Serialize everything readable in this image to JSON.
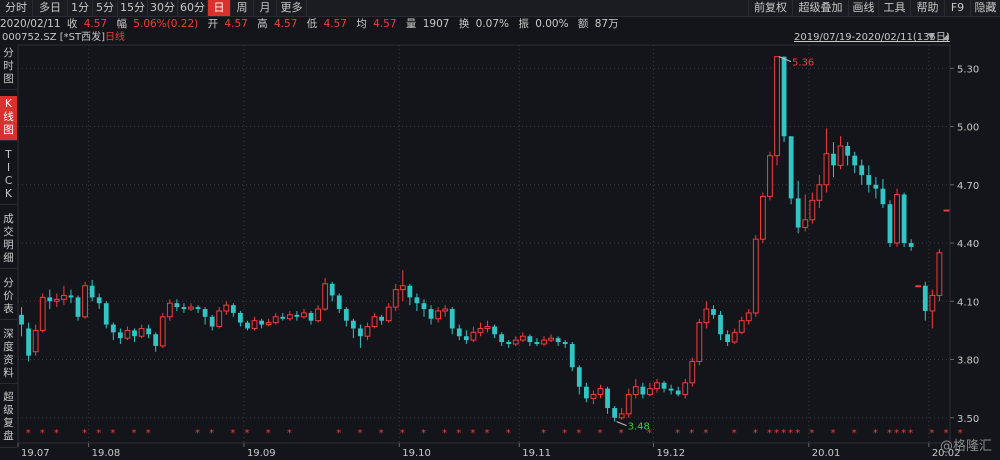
{
  "top_tabs": [
    "分时",
    "多日",
    "1分",
    "5分",
    "15分",
    "30分",
    "60分",
    "日",
    "周",
    "月",
    "更多"
  ],
  "active_tab": "日",
  "right_menu": [
    "前复权",
    "超级叠加",
    "画线",
    "工具",
    "帮助",
    "F9",
    "隐藏"
  ],
  "quote": {
    "date": "2020/02/11",
    "close_label": "收",
    "close": "4.57",
    "change_label": "幅",
    "change": "5.06%(0.22)",
    "open_label": "开",
    "open": "4.57",
    "high_label": "高",
    "high": "4.57",
    "low_label": "低",
    "low": "4.57",
    "avg_label": "均",
    "avg": "4.57",
    "volume_label": "量",
    "volume": "1907",
    "turnover_label": "换",
    "turnover": "0.07%",
    "amplitude_label": "振",
    "amplitude": "0.00%",
    "amount_label": "额",
    "amount": "87万"
  },
  "stock": {
    "code_name": "000752.SZ [*ST西发]",
    "period": "日线"
  },
  "range_label": "2019/07/19-2020/02/11(135日)",
  "sidebar": [
    "分时图",
    "K线图",
    "TICK",
    "成交明细",
    "分价表",
    "深度资料",
    "超级复盘"
  ],
  "watermark": "@格隆汇",
  "colors": {
    "up": "#f23c3c",
    "down": "#31c5c5",
    "background": "#14151a",
    "grid": "#3a3b40",
    "low_label": "#3ccb3c",
    "accent": "#d8312e"
  },
  "chart_data": {
    "type": "candlestick",
    "ylim": [
      3.37,
      5.42
    ],
    "y_ticks": [
      "5.30",
      "5.00",
      "4.70",
      "4.40",
      "4.10",
      "3.80",
      "3.50"
    ],
    "x_tick_labels": [
      "19.07",
      "19.08",
      "19.09",
      "19.10",
      "19.11",
      "19.12",
      "20.01",
      "20.02"
    ],
    "x_tick_index": [
      0,
      10,
      32,
      54,
      71,
      90,
      112,
      129
    ],
    "max_label": "5.36",
    "min_label": "3.48",
    "candles": [
      [
        4.03,
        3.98,
        4.07,
        3.92
      ],
      [
        3.96,
        3.82,
        3.99,
        3.79
      ],
      [
        3.84,
        3.95,
        3.98,
        3.82
      ],
      [
        3.95,
        4.12,
        4.14,
        3.94
      ],
      [
        4.12,
        4.1,
        4.16,
        4.06
      ],
      [
        4.1,
        4.11,
        4.14,
        4.07
      ],
      [
        4.11,
        4.13,
        4.18,
        4.08
      ],
      [
        4.13,
        4.12,
        4.16,
        4.09
      ],
      [
        4.12,
        4.02,
        4.13,
        4.0
      ],
      [
        4.02,
        4.18,
        4.2,
        4.01
      ],
      [
        4.18,
        4.12,
        4.21,
        4.1
      ],
      [
        4.12,
        4.09,
        4.14,
        4.06
      ],
      [
        4.09,
        3.98,
        4.1,
        3.96
      ],
      [
        3.98,
        3.94,
        3.99,
        3.9
      ],
      [
        3.94,
        3.91,
        3.96,
        3.88
      ],
      [
        3.91,
        3.95,
        3.97,
        3.9
      ],
      [
        3.95,
        3.92,
        3.96,
        3.89
      ],
      [
        3.92,
        3.96,
        3.98,
        3.91
      ],
      [
        3.96,
        3.93,
        3.98,
        3.91
      ],
      [
        3.93,
        3.87,
        3.94,
        3.84
      ],
      [
        3.87,
        4.02,
        4.04,
        3.86
      ],
      [
        4.02,
        4.09,
        4.11,
        4.0
      ],
      [
        4.09,
        4.07,
        4.11,
        4.05
      ],
      [
        4.07,
        4.06,
        4.09,
        4.04
      ],
      [
        4.06,
        4.07,
        4.09,
        4.05
      ],
      [
        4.07,
        4.06,
        4.08,
        4.04
      ],
      [
        4.06,
        4.02,
        4.07,
        3.98
      ],
      [
        4.02,
        3.97,
        4.03,
        3.95
      ],
      [
        3.97,
        4.05,
        4.07,
        3.96
      ],
      [
        4.05,
        4.08,
        4.1,
        4.03
      ],
      [
        4.08,
        4.04,
        4.09,
        4.02
      ],
      [
        4.04,
        3.99,
        4.05,
        3.97
      ],
      [
        3.99,
        3.96,
        4.0,
        3.95
      ],
      [
        3.96,
        4.0,
        4.02,
        3.95
      ],
      [
        4.0,
        3.98,
        4.01,
        3.96
      ],
      [
        3.98,
        3.99,
        4.01,
        3.97
      ],
      [
        3.99,
        4.02,
        4.04,
        3.98
      ],
      [
        4.02,
        4.01,
        4.04,
        4.0
      ],
      [
        4.01,
        4.03,
        4.05,
        4.0
      ],
      [
        4.03,
        4.02,
        4.05,
        4.0
      ],
      [
        4.02,
        4.04,
        4.06,
        4.01
      ],
      [
        4.04,
        4.0,
        4.05,
        3.98
      ],
      [
        4.0,
        4.06,
        4.08,
        3.99
      ],
      [
        4.06,
        4.19,
        4.22,
        4.05
      ],
      [
        4.19,
        4.13,
        4.2,
        4.1
      ],
      [
        4.13,
        4.06,
        4.14,
        4.04
      ],
      [
        4.06,
        4.0,
        4.07,
        3.97
      ],
      [
        4.0,
        3.96,
        4.01,
        3.91
      ],
      [
        3.96,
        3.92,
        3.98,
        3.86
      ],
      [
        3.92,
        3.97,
        3.99,
        3.9
      ],
      [
        3.97,
        4.02,
        4.04,
        3.96
      ],
      [
        4.02,
        4.0,
        4.03,
        3.98
      ],
      [
        4.0,
        4.07,
        4.09,
        3.99
      ],
      [
        4.07,
        4.16,
        4.19,
        4.05
      ],
      [
        4.16,
        4.18,
        4.26,
        4.1
      ],
      [
        4.18,
        4.12,
        4.19,
        4.08
      ],
      [
        4.12,
        4.09,
        4.14,
        4.05
      ],
      [
        4.09,
        4.06,
        4.11,
        4.02
      ],
      [
        4.06,
        4.01,
        4.08,
        3.98
      ],
      [
        4.01,
        4.05,
        4.07,
        3.99
      ],
      [
        4.05,
        4.06,
        4.08,
        4.02
      ],
      [
        4.06,
        3.96,
        4.07,
        3.93
      ],
      [
        3.96,
        3.92,
        3.98,
        3.9
      ],
      [
        3.92,
        3.9,
        3.95,
        3.88
      ],
      [
        3.9,
        3.94,
        3.97,
        3.89
      ],
      [
        3.94,
        3.96,
        3.99,
        3.92
      ],
      [
        3.96,
        3.97,
        4.0,
        3.94
      ],
      [
        3.97,
        3.93,
        3.98,
        3.91
      ],
      [
        3.93,
        3.89,
        3.94,
        3.87
      ],
      [
        3.89,
        3.88,
        3.9,
        3.86
      ],
      [
        3.88,
        3.9,
        3.92,
        3.87
      ],
      [
        3.9,
        3.92,
        3.94,
        3.89
      ],
      [
        3.92,
        3.89,
        3.93,
        3.87
      ],
      [
        3.89,
        3.88,
        3.91,
        3.87
      ],
      [
        3.88,
        3.9,
        3.92,
        3.87
      ],
      [
        3.9,
        3.91,
        3.93,
        3.89
      ],
      [
        3.91,
        3.89,
        3.92,
        3.87
      ],
      [
        3.89,
        3.88,
        3.9,
        3.86
      ],
      [
        3.88,
        3.76,
        3.89,
        3.74
      ],
      [
        3.76,
        3.66,
        3.77,
        3.62
      ],
      [
        3.66,
        3.6,
        3.68,
        3.58
      ],
      [
        3.6,
        3.62,
        3.64,
        3.57
      ],
      [
        3.62,
        3.65,
        3.67,
        3.6
      ],
      [
        3.65,
        3.55,
        3.66,
        3.52
      ],
      [
        3.55,
        3.5,
        3.56,
        3.48
      ],
      [
        3.5,
        3.52,
        3.55,
        3.49
      ],
      [
        3.52,
        3.62,
        3.65,
        3.5
      ],
      [
        3.62,
        3.66,
        3.7,
        3.6
      ],
      [
        3.66,
        3.62,
        3.68,
        3.6
      ],
      [
        3.62,
        3.65,
        3.68,
        3.61
      ],
      [
        3.65,
        3.68,
        3.7,
        3.63
      ],
      [
        3.68,
        3.65,
        3.69,
        3.63
      ],
      [
        3.65,
        3.64,
        3.67,
        3.62
      ],
      [
        3.64,
        3.62,
        3.66,
        3.61
      ],
      [
        3.62,
        3.68,
        3.7,
        3.6
      ],
      [
        3.68,
        3.79,
        3.81,
        3.66
      ],
      [
        3.79,
        3.99,
        4.01,
        3.77
      ],
      [
        3.99,
        4.06,
        4.1,
        3.96
      ],
      [
        4.06,
        4.03,
        4.08,
        4.01
      ],
      [
        4.03,
        3.93,
        4.05,
        3.9
      ],
      [
        3.93,
        3.89,
        3.95,
        3.87
      ],
      [
        3.89,
        3.94,
        3.96,
        3.88
      ],
      [
        3.94,
        4.0,
        4.02,
        3.93
      ],
      [
        4.0,
        4.04,
        4.06,
        3.98
      ],
      [
        4.04,
        4.42,
        4.44,
        4.02
      ],
      [
        4.42,
        4.64,
        4.66,
        4.4
      ],
      [
        4.64,
        4.85,
        4.87,
        4.62
      ],
      [
        4.85,
        5.36,
        5.36,
        4.8
      ],
      [
        5.36,
        4.95,
        5.02,
        4.92
      ],
      [
        4.95,
        4.63,
        4.9,
        4.6
      ],
      [
        4.63,
        4.48,
        4.72,
        4.45
      ],
      [
        4.48,
        4.52,
        4.65,
        4.46
      ],
      [
        4.52,
        4.62,
        4.66,
        4.5
      ],
      [
        4.62,
        4.7,
        4.75,
        4.58
      ],
      [
        4.7,
        4.86,
        4.99,
        4.66
      ],
      [
        4.86,
        4.8,
        4.92,
        4.74
      ],
      [
        4.8,
        4.9,
        4.95,
        4.78
      ],
      [
        4.9,
        4.85,
        4.92,
        4.8
      ],
      [
        4.85,
        4.8,
        4.87,
        4.76
      ],
      [
        4.8,
        4.75,
        4.83,
        4.7
      ],
      [
        4.75,
        4.7,
        4.8,
        4.66
      ],
      [
        4.7,
        4.68,
        4.74,
        4.63
      ],
      [
        4.68,
        4.6,
        4.73,
        4.58
      ],
      [
        4.6,
        4.4,
        4.62,
        4.38
      ],
      [
        4.4,
        4.65,
        4.68,
        4.38
      ],
      [
        4.65,
        4.4,
        4.66,
        4.38
      ],
      [
        4.4,
        4.38,
        4.42,
        4.36
      ],
      [
        4.18,
        4.18,
        4.18,
        4.18
      ],
      [
        4.18,
        4.05,
        4.2,
        4.0
      ],
      [
        4.05,
        4.13,
        4.16,
        3.96
      ],
      [
        4.13,
        4.35,
        4.37,
        4.1
      ],
      [
        4.57,
        4.57,
        4.57,
        4.57
      ]
    ],
    "marker_index": [
      1,
      3,
      5,
      9,
      11,
      13,
      16,
      18,
      25,
      27,
      30,
      32,
      35,
      38,
      45,
      48,
      51,
      54,
      57,
      60,
      62,
      64,
      66,
      69,
      74,
      77,
      79,
      82,
      85,
      89,
      93,
      95,
      97,
      101,
      104,
      106,
      107,
      108,
      109,
      110,
      112,
      115,
      118,
      121,
      123,
      124,
      125,
      126,
      129,
      131,
      133
    ]
  }
}
